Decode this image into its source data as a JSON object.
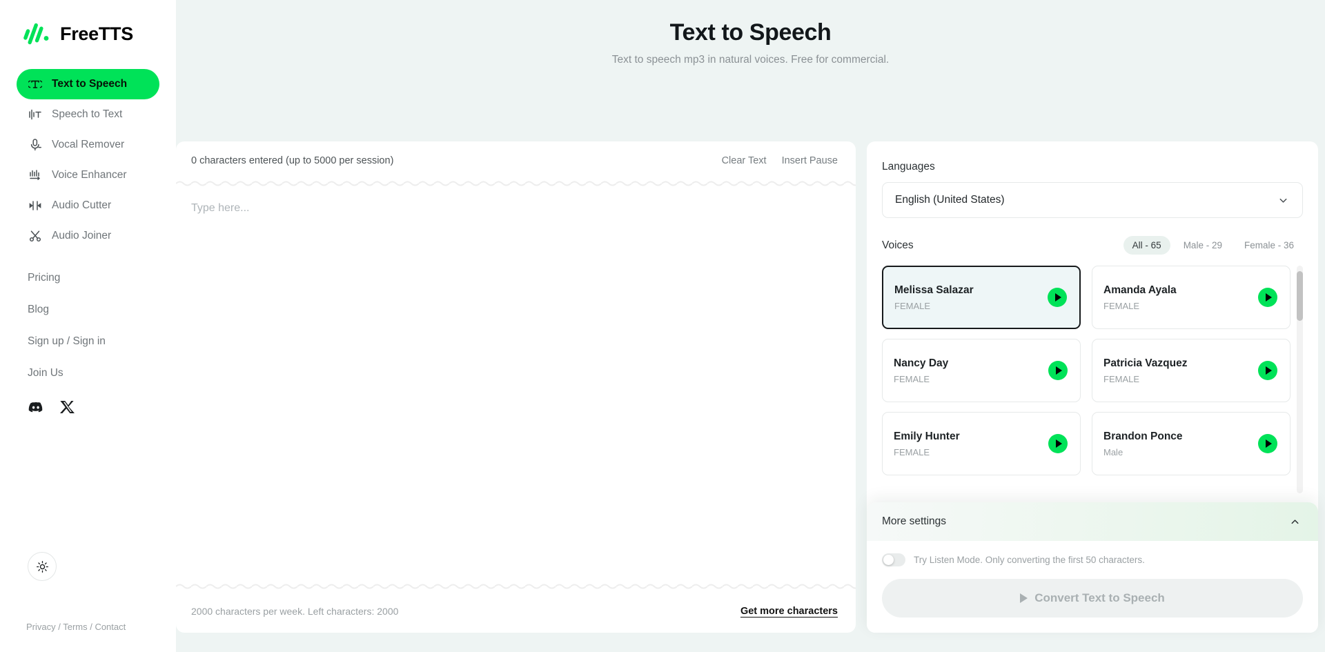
{
  "brand": {
    "name": "FreeTTS",
    "logo_icon": "freetts-waveform-logo"
  },
  "sidebar": {
    "primary": [
      {
        "label": "Text to Speech",
        "icon": "text-to-speech-icon",
        "active": true
      },
      {
        "label": "Speech to Text",
        "icon": "speech-to-text-icon",
        "active": false
      },
      {
        "label": "Vocal Remover",
        "icon": "microphone-icon",
        "active": false
      },
      {
        "label": "Voice Enhancer",
        "icon": "voice-enhancer-icon",
        "active": false
      },
      {
        "label": "Audio Cutter",
        "icon": "audio-cutter-icon",
        "active": false
      },
      {
        "label": "Audio Joiner",
        "icon": "scissors-icon",
        "active": false
      }
    ],
    "secondary": [
      {
        "label": "Pricing"
      },
      {
        "label": "Blog"
      },
      {
        "label": "Sign up / Sign in"
      },
      {
        "label": "Join Us"
      }
    ],
    "socials": [
      {
        "name": "discord-icon"
      },
      {
        "name": "x-twitter-icon"
      }
    ],
    "theme_toggle_icon": "sun-icon",
    "legal": "Privacy / Terms / Contact"
  },
  "header": {
    "title": "Text to Speech",
    "subtitle": "Text to speech mp3 in natural voices. Free for commercial."
  },
  "editor": {
    "char_count": "0 characters entered (up to 5000 per session)",
    "clear_text": "Clear Text",
    "insert_pause": "Insert Pause",
    "placeholder": "Type here...",
    "value": "",
    "quota_note": "2000 characters per week. Left characters: 2000",
    "get_more": "Get more characters"
  },
  "panel": {
    "languages_label": "Languages",
    "language_selected": "English (United States)",
    "voices_label": "Voices",
    "filters": [
      {
        "label": "All - 65",
        "active": true
      },
      {
        "label": "Male - 29",
        "active": false
      },
      {
        "label": "Female - 36",
        "active": false
      }
    ],
    "voices": [
      {
        "name": "Melissa Salazar",
        "gender": "FEMALE",
        "selected": true
      },
      {
        "name": "Amanda Ayala",
        "gender": "FEMALE",
        "selected": false
      },
      {
        "name": "Nancy Day",
        "gender": "FEMALE",
        "selected": false
      },
      {
        "name": "Patricia Vazquez",
        "gender": "FEMALE",
        "selected": false
      },
      {
        "name": "Emily Hunter",
        "gender": "FEMALE",
        "selected": false
      },
      {
        "name": "Brandon Ponce",
        "gender": "Male",
        "selected": false
      }
    ]
  },
  "settings": {
    "title": "More settings",
    "collapse_icon": "chevron-up-icon",
    "listen_mode_label": "Try Listen Mode. Only converting the first 50 characters.",
    "listen_mode_on": false,
    "convert_label": "Convert Text to Speech",
    "convert_disabled": true
  },
  "colors": {
    "accent_green": "#00e258",
    "page_bg": "#eef4f3",
    "selected_card_bg": "#eef6f7"
  }
}
